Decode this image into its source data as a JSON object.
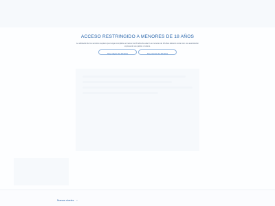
{
  "age_gate": {
    "title": "ACCESO RESTRINGIDO A MENORES DE 18 AÑOS",
    "notice": "La utilización de los servicios requiere que tengas cumplidos al menos los 18 años de edad. Los menores de 18 años deberán contar con una autorización expresa de sus padres o tutores.",
    "over_18_button": "Soy mayor de 18 años",
    "under_18_button": "Soy menor de 18 años",
    "accent_color": "#1f5fa8"
  },
  "footer": {
    "link_label": "Nuevos niveles",
    "link_icon": "chevron-right-icon"
  }
}
